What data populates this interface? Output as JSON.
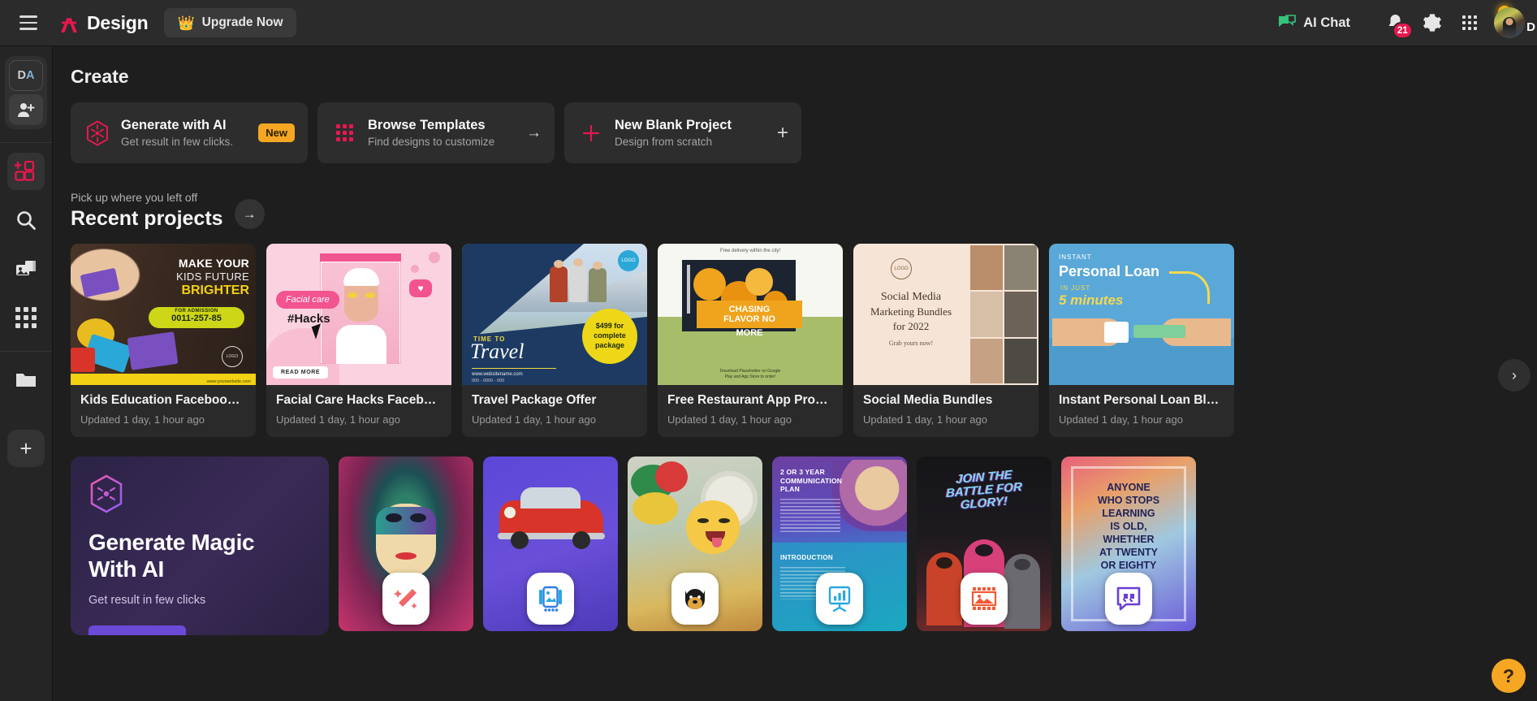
{
  "topbar": {
    "brand_name": "Design",
    "upgrade_label": "Upgrade Now",
    "ai_chat_label": "AI Chat",
    "notification_count": "21",
    "avatar_letter": "D"
  },
  "rail": {
    "initials_d": "D",
    "initials_a": "A",
    "items": [
      {
        "name": "add-person",
        "label": "Add person"
      },
      {
        "name": "add-element",
        "label": "Add element"
      },
      {
        "name": "search",
        "label": "Search"
      },
      {
        "name": "media",
        "label": "Media"
      },
      {
        "name": "apps",
        "label": "Apps"
      },
      {
        "name": "folder",
        "label": "Folder"
      },
      {
        "name": "add",
        "label": "Add"
      }
    ]
  },
  "create": {
    "heading": "Create",
    "cards": [
      {
        "title": "Generate with AI",
        "subtitle": "Get result in few clicks.",
        "badge": "New",
        "icon": "ai-hex-icon"
      },
      {
        "title": "Browse Templates",
        "subtitle": "Find designs to customize",
        "badge": "→",
        "icon": "grid-icon"
      },
      {
        "title": "New Blank Project",
        "subtitle": "Design from scratch",
        "badge": "+",
        "icon": "plus-icon"
      }
    ]
  },
  "recent": {
    "eyebrow": "Pick up where you left off",
    "title": "Recent projects",
    "arrow": "→",
    "next_arrow": "›",
    "projects": [
      {
        "name": "Kids Education Facebook…",
        "updated": "Updated 1 day, 1 hour ago",
        "art": {
          "kind": "kids-education",
          "line1": "MAKE YOUR",
          "line2": "KIDS FUTURE",
          "line3": "BRIGHTER",
          "badge_label": "FOR ADMISSION",
          "phone": "0011-257-85",
          "logo": "LOGO",
          "url": "www.yourwebsite.com"
        }
      },
      {
        "name": "Facial Care Hacks Faceb…",
        "updated": "Updated 1 day, 1 hour ago",
        "art": {
          "kind": "facial-care",
          "pill": "Facial care",
          "hashtag": "#Hacks",
          "cta": "READ MORE"
        }
      },
      {
        "name": "Travel Package Offer",
        "updated": "Updated 1 day, 1 hour ago",
        "art": {
          "kind": "travel",
          "kicker": "TIME TO",
          "headline": "Travel",
          "url": "www.websitename.com",
          "phone": "000 - 0000 - 000",
          "logo": "LOGO",
          "offer_line1": "$499 for",
          "offer_line2": "complete",
          "offer_line3": "package"
        }
      },
      {
        "name": "Free Restaurant App Pro…",
        "updated": "Updated 1 day, 1 hour ago",
        "art": {
          "kind": "restaurant",
          "top_note": "Free delivery within the city!",
          "line1": "CHASING",
          "line2": "FLAVOR NO",
          "line3": "MORE",
          "footer1": "Download Placeholder on Google",
          "footer2": "Play and App Store to order!"
        }
      },
      {
        "name": "Social Media Bundles",
        "updated": "Updated 1 day, 1 hour ago",
        "art": {
          "kind": "social-bundles",
          "logo": "LOGO",
          "line1": "Social Media",
          "line2": "Marketing Bundles",
          "line3": "for 2022",
          "cta": "Grab yours now!"
        }
      },
      {
        "name": "Instant Personal Loan Bl…",
        "updated": "Updated 1 day, 1 hour ago",
        "art": {
          "kind": "personal-loan",
          "kicker": "INSTANT",
          "headline": "Personal Loan",
          "sub1": "IN JUST",
          "sub2": "5 minutes"
        }
      }
    ]
  },
  "promo": {
    "title_line1": "Generate Magic",
    "title_line2": "With AI",
    "subtitle": "Get result in few clicks",
    "icon": "ai-hex-icon"
  },
  "tiles": [
    {
      "name": "magic-edit-tile",
      "icon": "magic-wand-icon",
      "art": "mask-portrait"
    },
    {
      "name": "photo-collage-tile",
      "icon": "image-stack-icon",
      "art": "red-car"
    },
    {
      "name": "sticker-tile",
      "icon": "dog-sticker-icon",
      "art": "emoji-balloon"
    },
    {
      "name": "presentation-tile",
      "icon": "chart-board-icon",
      "art": "communication-plan",
      "art_text": {
        "title1": "2 OR 3 YEAR",
        "title2": "COMMUNICATION",
        "title3": "PLAN",
        "section": "INTRODUCTION"
      }
    },
    {
      "name": "poster-tile",
      "icon": "image-frame-icon",
      "art": "battle-poster",
      "art_text": {
        "line1": "JOIN THE",
        "line2": "BATTLE FOR",
        "line3": "GLORY!"
      }
    },
    {
      "name": "quote-tile",
      "icon": "quote-icon",
      "art": "quote-gradient",
      "art_text": {
        "l1": "ANYONE",
        "l2": "WHO STOPS",
        "l3": "LEARNING",
        "l4": "IS OLD,",
        "l5": "WHETHER",
        "l6": "AT TWENTY",
        "l7": "OR EIGHTY"
      }
    }
  ],
  "help": {
    "label": "?"
  },
  "colors": {
    "accent": "#e8174e",
    "amber": "#f5a623",
    "bg": "#1e1e1e",
    "panel": "#2d2d2d",
    "topbar": "#2b2b2b"
  }
}
